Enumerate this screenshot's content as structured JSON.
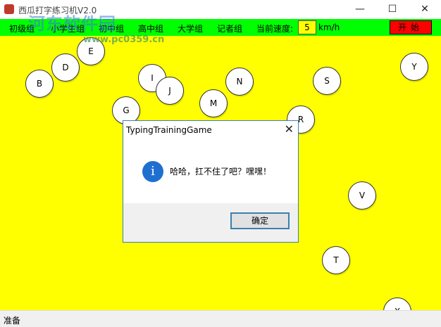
{
  "window": {
    "title": "西瓜打字练习机V2.0",
    "minimize": "—",
    "maximize": "☐",
    "close": "✕"
  },
  "watermark": {
    "brand": "河东软件园",
    "url": "www.pc0359.cn"
  },
  "menu": {
    "items": [
      "初级组",
      "小学生组",
      "初中组",
      "高中组",
      "大学组",
      "记者组"
    ],
    "speed_label": "当前速度:",
    "speed_value": "5",
    "speed_unit": "km/h",
    "start_button": "开始"
  },
  "balls": [
    "E",
    "D",
    "B",
    "I",
    "J",
    "N",
    "S",
    "Y",
    "G",
    "M",
    "R",
    "V",
    "T",
    "X"
  ],
  "dialog": {
    "title": "TypingTrainingGame",
    "icon": "info-icon",
    "message": "哈哈，扛不住了吧？嘿嘿！",
    "ok_button": "确定",
    "close": "✕"
  },
  "status": {
    "text": "准备"
  },
  "colors": {
    "menubar": "#00ff00",
    "playfield": "#ffff00",
    "start_button": "#ff0000",
    "dialog_border": "#3c7fb1",
    "info_icon": "#1f6fd1"
  }
}
